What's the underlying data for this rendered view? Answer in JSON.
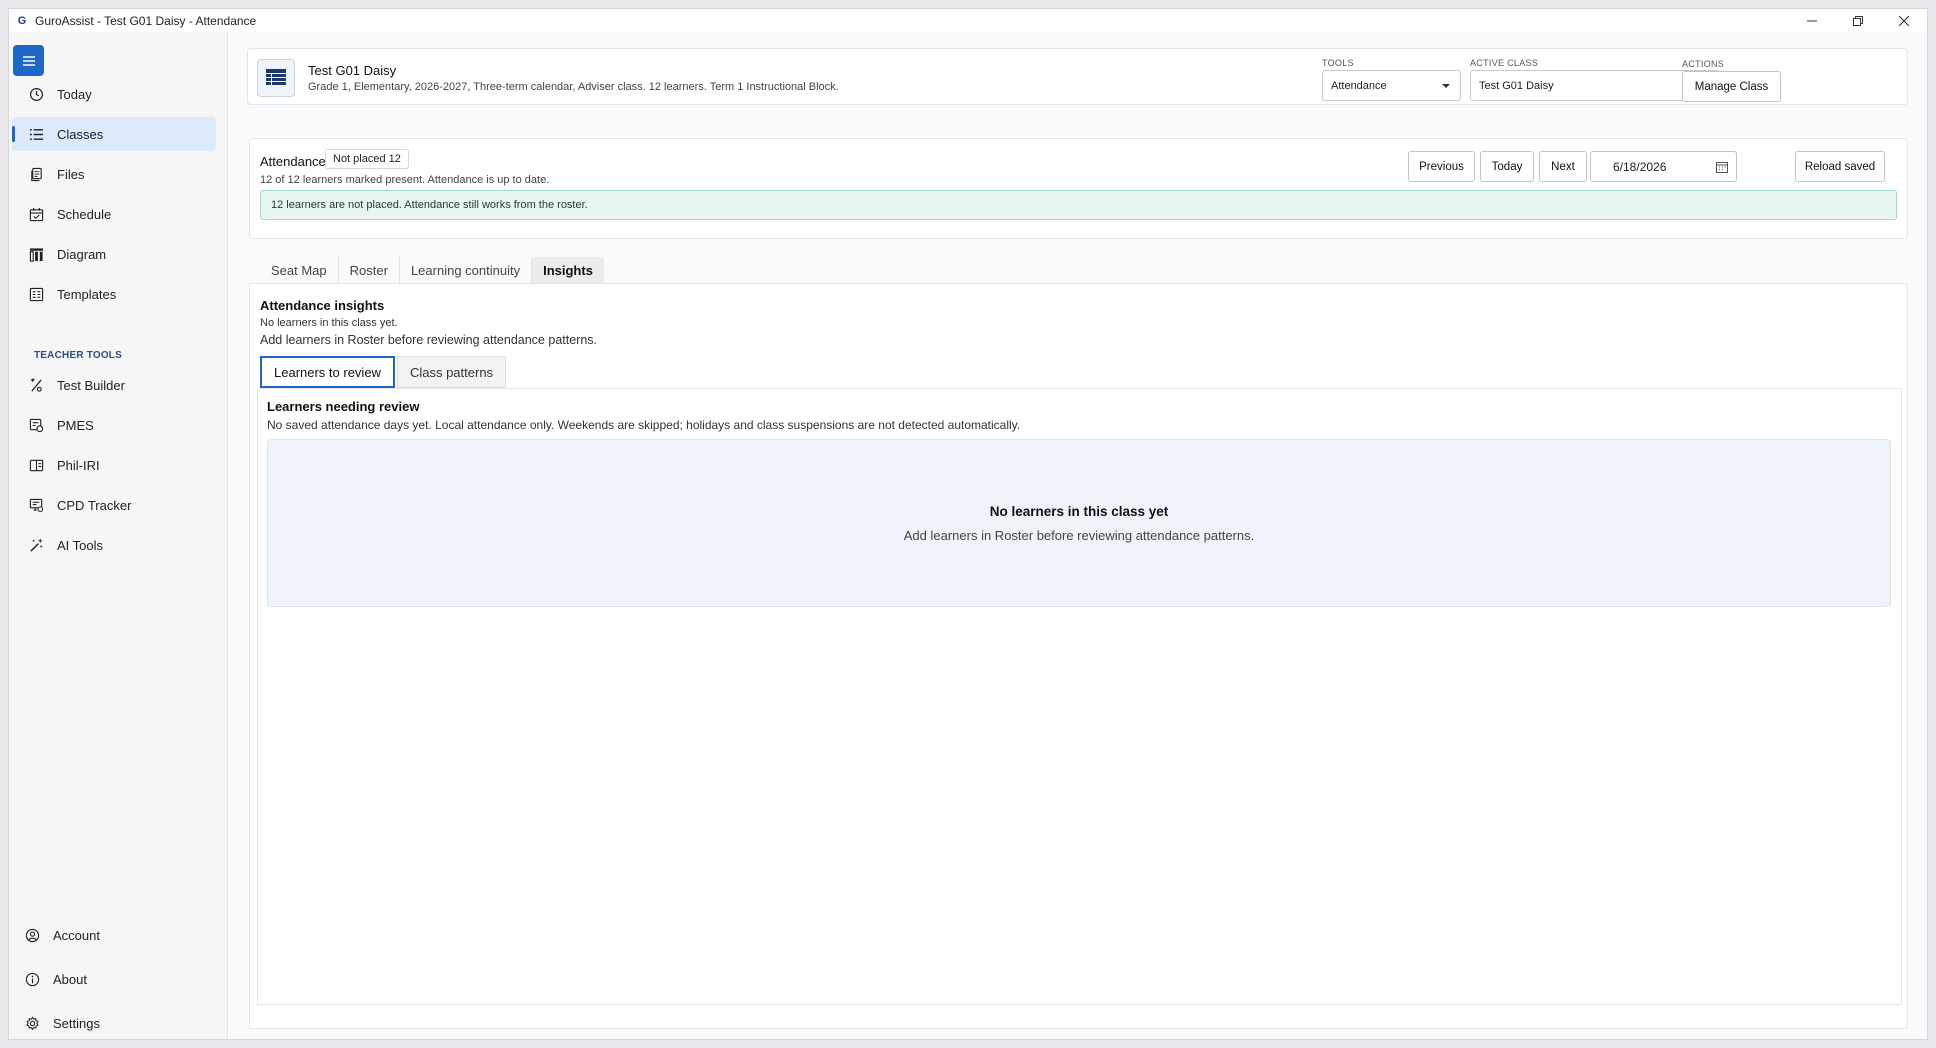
{
  "window": {
    "title": "GuroAssist - Test G01 Daisy - Attendance",
    "logo_letter": "G"
  },
  "sidebar": {
    "items": [
      {
        "label": "Today",
        "icon": "clock-icon"
      },
      {
        "label": "Classes",
        "icon": "list-icon",
        "active": true
      },
      {
        "label": "Files",
        "icon": "files-icon"
      },
      {
        "label": "Schedule",
        "icon": "calendar-icon"
      },
      {
        "label": "Diagram",
        "icon": "diagram-icon"
      },
      {
        "label": "Templates",
        "icon": "templates-icon"
      }
    ],
    "section_label": "TEACHER TOOLS",
    "tools": [
      {
        "label": "Test Builder",
        "icon": "percent-icon"
      },
      {
        "label": "PMES",
        "icon": "pmes-icon"
      },
      {
        "label": "Phil-IRI",
        "icon": "book-icon"
      },
      {
        "label": "CPD Tracker",
        "icon": "tracker-icon"
      },
      {
        "label": "AI Tools",
        "icon": "magic-wand-icon"
      }
    ],
    "bottom": [
      {
        "label": "Account",
        "icon": "account-icon"
      },
      {
        "label": "About",
        "icon": "info-icon"
      },
      {
        "label": "Settings",
        "icon": "gear-icon"
      }
    ]
  },
  "class_header": {
    "name": "Test G01 Daisy",
    "meta": "Grade 1, Elementary, 2026-2027, Three-term calendar, Adviser class. 12 learners. Term 1 Instructional Block.",
    "tools_label": "TOOLS",
    "tools_value": "Attendance",
    "active_class_label": "ACTIVE CLASS",
    "active_class_value": "Test G01 Daisy",
    "actions_label": "ACTIONS",
    "manage_button": "Manage Class"
  },
  "attendance": {
    "title": "Attendance",
    "badge": "Not placed 12",
    "summary": "12 of 12 learners marked present. Attendance is up to date.",
    "previous_button": "Previous",
    "today_button": "Today",
    "next_button": "Next",
    "date_value": "6/18/2026",
    "reload_button": "Reload saved",
    "notice": "12 learners are not placed. Attendance still works from the roster."
  },
  "tabs": [
    "Seat Map",
    "Roster",
    "Learning continuity",
    "Insights"
  ],
  "active_tab": "Insights",
  "insights": {
    "title": "Attendance insights",
    "line1": "No learners in this class yet.",
    "line2": "Add learners in Roster before reviewing attendance patterns.",
    "subtabs": [
      "Learners to review",
      "Class patterns"
    ],
    "review_title": "Learners needing review",
    "review_sub": "No saved attendance days yet. Local attendance only. Weekends are skipped; holidays and class suspensions are not detected automatically.",
    "empty_title": "No learners in this class yet",
    "empty_sub": "Add learners in Roster before reviewing attendance patterns."
  },
  "colors": {
    "accent": "#1f66c9",
    "nav_active_bg": "#dbe9f8",
    "notice_bg": "#e7f6ef",
    "empty_bg": "#eef3f9"
  }
}
